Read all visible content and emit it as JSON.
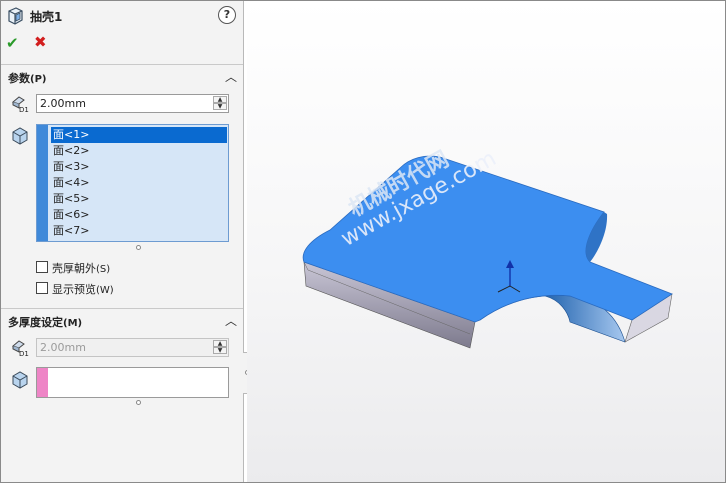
{
  "feature": {
    "title": "抽壳1",
    "icon": "shell-feature-icon",
    "help_icon": "help-icon",
    "help_glyph": "?"
  },
  "actions": {
    "ok_glyph": "✔",
    "cancel_glyph": "✖"
  },
  "parameters": {
    "header": "参数",
    "header_key": "(P)",
    "thickness": "2.00mm",
    "faces": [
      "面<1>",
      "面<2>",
      "面<3>",
      "面<4>",
      "面<5>",
      "面<6>",
      "面<7>"
    ],
    "selected_face_index": 0,
    "list_color": "#3f89d9",
    "options": [
      {
        "label": "壳厚朝外",
        "key": "(S)",
        "checked": false
      },
      {
        "label": "显示预览",
        "key": "(W)",
        "checked": false
      }
    ]
  },
  "multi_thickness": {
    "header": "多厚度设定",
    "header_key": "(M)",
    "thickness": "2.00mm",
    "list_color": "#ee85c6"
  },
  "watermark": {
    "line1": "机械时代网",
    "line2": "www.jxage.com"
  },
  "model_color": "#3c8ef0"
}
